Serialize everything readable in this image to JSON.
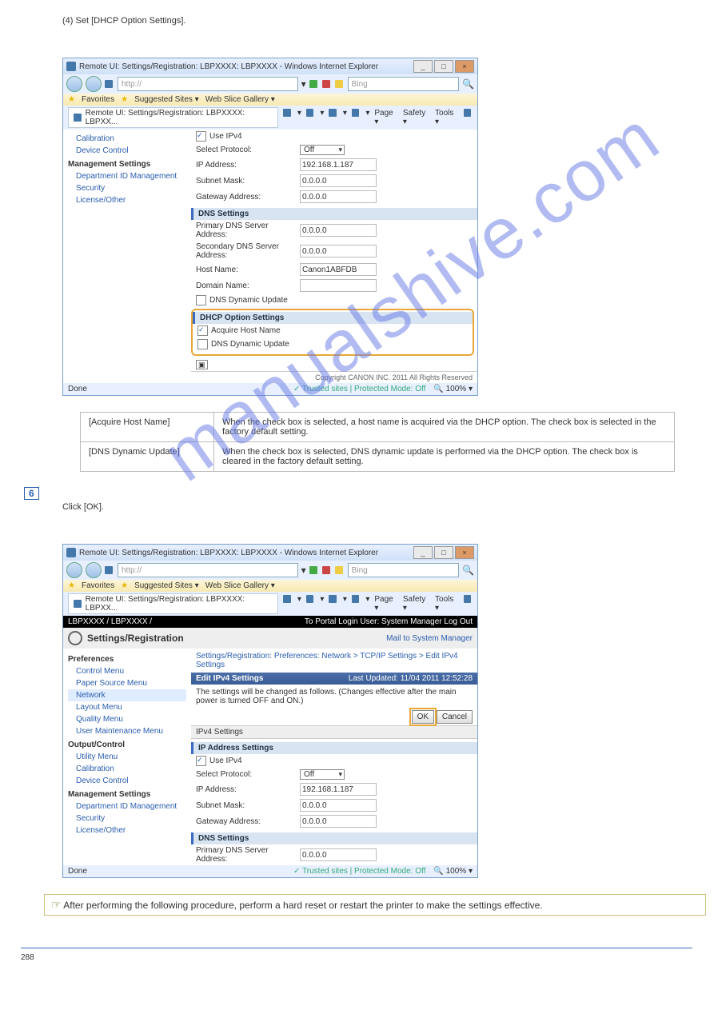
{
  "step5_label": "(4) Set [DHCP Option Settings].",
  "screenshot1": {
    "title": "Remote UI: Settings/Registration: LBPXXXX: LBPXXXX - Windows Internet Explorer",
    "url": "http://",
    "search_engine": "Bing",
    "favorites": "Favorites",
    "suggested": "Suggested Sites ▾",
    "webslice": "Web Slice Gallery ▾",
    "tab": "Remote UI: Settings/Registration: LBPXXXX: LBPXX...",
    "tools": [
      "Page ▾",
      "Safety ▾",
      "Tools ▾"
    ],
    "sidebar": {
      "items_top": [
        "Calibration",
        "Device Control"
      ],
      "heading1": "Management Settings",
      "items1": [
        "Department ID Management",
        "Security",
        "License/Other"
      ]
    },
    "main": {
      "use_ipv4": "Use IPv4",
      "select_protocol": "Select Protocol:",
      "select_protocol_val": "Off",
      "ip_address": "IP Address:",
      "ip_address_val": "192.168.1.187",
      "subnet": "Subnet Mask:",
      "subnet_val": "0.0.0.0",
      "gateway": "Gateway Address:",
      "gateway_val": "0.0.0.0",
      "dns_hdr": "DNS Settings",
      "primary_dns": "Primary DNS Server Address:",
      "primary_dns_val": "0.0.0.0",
      "secondary_dns": "Secondary DNS Server Address:",
      "secondary_dns_val": "0.0.0.0",
      "host_name": "Host Name:",
      "host_name_val": "Canon1ABFDB",
      "domain_name": "Domain Name:",
      "dns_dynamic": "DNS Dynamic Update",
      "dhcp_hdr": "DHCP Option Settings",
      "acquire_host": "Acquire Host Name",
      "dns_dynamic2": "DNS Dynamic Update",
      "copyright": "Copyright CANON INC. 2011 All Rights Reserved"
    },
    "status_done": "Done",
    "status_trusted": "Trusted sites | Protected Mode: Off",
    "status_zoom": "100%"
  },
  "options_table": {
    "r1c1": "[Acquire Host Name]",
    "r1c2": "When the check box is selected, a host name is acquired via the DHCP option. The check box is selected in the factory default setting.",
    "r2c1": "[DNS Dynamic Update]",
    "r2c2": "When the check box is selected, DNS dynamic update is performed via the DHCP option. The check box is cleared in the factory default setting."
  },
  "step6_num": "6",
  "step6_label": "Click [OK].",
  "screenshot2": {
    "title": "Remote UI: Settings/Registration: LBPXXXX: LBPXXXX - Windows Internet Explorer",
    "url": "http://",
    "search_engine": "Bing",
    "favorites": "Favorites",
    "suggested": "Suggested Sites ▾",
    "webslice": "Web Slice Gallery ▾",
    "tab": "Remote UI: Settings/Registration: LBPXXXX: LBPXX...",
    "tools": [
      "Page ▾",
      "Safety ▾",
      "Tools ▾"
    ],
    "blackbar_left": "LBPXXXX / LBPXXXX /",
    "blackbar_right": "To Portal   Login User: System Manager Log Out",
    "reg_title": "Settings/Registration",
    "mailto": "Mail to System Manager",
    "sidebar": {
      "heading0": "Preferences",
      "items0": [
        "Control Menu",
        "Paper Source Menu",
        "Network",
        "Layout Menu",
        "Quality Menu",
        "User Maintenance Menu"
      ],
      "heading1": "Output/Control",
      "items1": [
        "Utility Menu",
        "Calibration",
        "Device Control"
      ],
      "heading2": "Management Settings",
      "items2": [
        "Department ID Management",
        "Security",
        "License/Other"
      ]
    },
    "breadcrumb": "Settings/Registration: Preferences: Network > TCP/IP Settings > Edit IPv4 Settings",
    "edit_hdr": "Edit IPv4 Settings",
    "edit_ts": "Last Updated: 11/04 2011 12:52:28",
    "notice": "The settings will be changed as follows. (Changes effective after the main power is turned OFF and ON.)",
    "ok": "OK",
    "cancel": "Cancel",
    "ipv4_hdr": "IPv4 Settings",
    "ipaddr_hdr": "IP Address Settings",
    "use_ipv4": "Use IPv4",
    "select_protocol": "Select Protocol:",
    "select_protocol_val": "Off",
    "ip_address": "IP Address:",
    "ip_address_val": "192.168.1.187",
    "subnet": "Subnet Mask:",
    "subnet_val": "0.0.0.0",
    "gateway": "Gateway Address:",
    "gateway_val": "0.0.0.0",
    "dns_hdr": "DNS Settings",
    "primary_dns": "Primary DNS Server Address:",
    "primary_dns_val": "0.0.0.0",
    "status_done": "Done",
    "status_trusted": "Trusted sites | Protected Mode: Off",
    "status_zoom": "100%"
  },
  "note_text": "After performing the following procedure, perform a hard reset or restart the printer to make the settings effective.",
  "page_number": "288"
}
